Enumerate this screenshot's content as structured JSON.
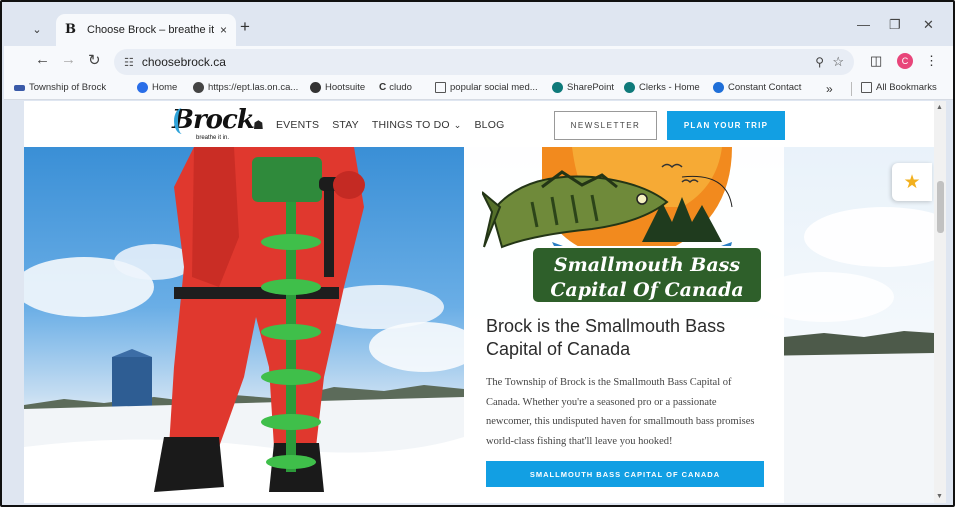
{
  "browser": {
    "tab_title": "Choose Brock – breathe it in",
    "tab_close": "×",
    "new_tab": "+",
    "tab_favicon": "B",
    "url": "choosebrock.ca",
    "profile_initial": "C",
    "bookmarks": [
      {
        "label": "Township of Brock",
        "icon": "township-icon",
        "color": "#3a5aa8"
      },
      {
        "label": "Home",
        "icon": "home-globe-icon",
        "color": "#2a6ee8"
      },
      {
        "label": "https://ept.las.on.ca...",
        "icon": "globe-icon",
        "color": "#444444"
      },
      {
        "label": "Hootsuite",
        "icon": "owl-icon",
        "color": "#333333"
      },
      {
        "label": "cludo",
        "icon": "cludo-icon",
        "color": "#111111"
      },
      {
        "label": "popular social med...",
        "icon": "folder-icon",
        "color": "#555555"
      },
      {
        "label": "SharePoint",
        "icon": "sharepoint-icon",
        "color": "#0f7a7a"
      },
      {
        "label": "Clerks - Home",
        "icon": "sharepoint-icon",
        "color": "#0f7a7a"
      },
      {
        "label": "Constant Contact",
        "icon": "constant-contact-icon",
        "color": "#1f6fd8"
      }
    ],
    "more_bookmarks": "»",
    "all_bookmarks": "All Bookmarks"
  },
  "site": {
    "logo_word": "Brock",
    "logo_tagline": "breathe it in.",
    "nav": {
      "events": "EVENTS",
      "stay": "STAY",
      "things_to_do": "THINGS TO DO",
      "blog": "BLOG"
    },
    "newsletter_button": "NEWSLETTER",
    "plan_button": "PLAN YOUR TRIP"
  },
  "hero": {
    "badge_line1": "Smallmouth Bass",
    "badge_line2": "Capital Of Canada",
    "headline": "Brock is the Smallmouth Bass Capital of Canada",
    "body": "The Township of Brock is the Smallmouth Bass Capital of Canada. Whether you're a seasoned pro or a passionate newcomer, this undisputed haven for smallmouth bass promises world-class fishing that'll leave you hooked!",
    "cta": "SMALLMOUTH BASS CAPITAL OF CANADA"
  },
  "colors": {
    "accent": "#129fe3",
    "badge_green": "#2e5f2a",
    "badge_orange": "#f28a1e"
  }
}
